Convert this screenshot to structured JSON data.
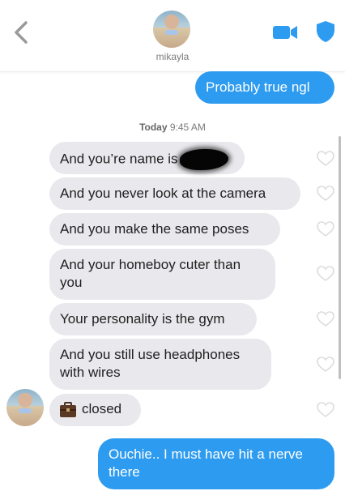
{
  "header": {
    "contact_name": "mikayla",
    "back_icon": "chevron-left-icon",
    "video_icon": "video-camera-icon",
    "shield_icon": "shield-icon",
    "accent_color": "#2d9bf0"
  },
  "thread": {
    "timestamp_day": "Today",
    "timestamp_time": "9:45 AM",
    "messages": [
      {
        "from": "me",
        "text": "Probably true ngl"
      },
      {
        "from": "them",
        "text": "And you’re name is",
        "redacted": true
      },
      {
        "from": "them",
        "text": "And you never look at the camera"
      },
      {
        "from": "them",
        "text": "And you make the same poses"
      },
      {
        "from": "them",
        "text": "And your homeboy cuter than you"
      },
      {
        "from": "them",
        "text": "Your personality is the gym"
      },
      {
        "from": "them",
        "text": "And you still use headphones with wires"
      },
      {
        "from": "them",
        "text": "closed",
        "icon": "briefcase-icon"
      },
      {
        "from": "me",
        "text": "Ouchie.. I must have hit a nerve there"
      }
    ]
  },
  "colors": {
    "outgoing_bubble": "#2d9bf0",
    "incoming_bubble": "#e9e9ed"
  }
}
